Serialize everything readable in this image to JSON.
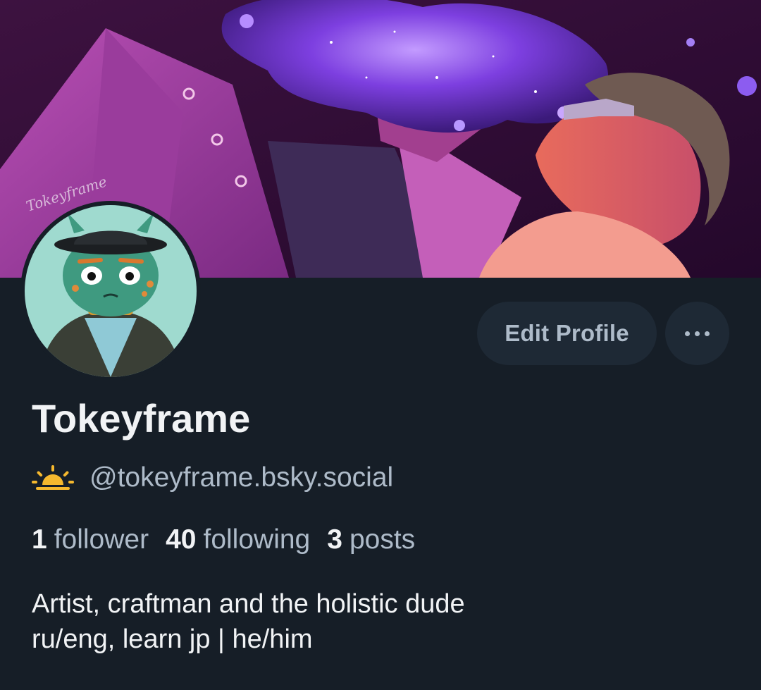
{
  "profile": {
    "display_name": "Tokeyframe",
    "handle": "@tokeyframe.bsky.social",
    "handle_icon": "sun-icon",
    "bio_line1": "Artist, craftman and the holistic dude",
    "bio_line2": "ru/eng, learn jp | he/him"
  },
  "stats": {
    "followers_count": "1",
    "followers_label": "follower",
    "following_count": "40",
    "following_label": "following",
    "posts_count": "3",
    "posts_label": "posts"
  },
  "actions": {
    "edit_profile_label": "Edit Profile",
    "more_icon": "ellipsis-icon"
  },
  "banner": {
    "signature": "Tokeyframe"
  },
  "colors": {
    "background": "#161e27",
    "button_bg": "#1e2935",
    "text_primary": "#f1f3f5",
    "text_secondary": "#aebbc9",
    "sun_icon": "#f5b82e"
  }
}
